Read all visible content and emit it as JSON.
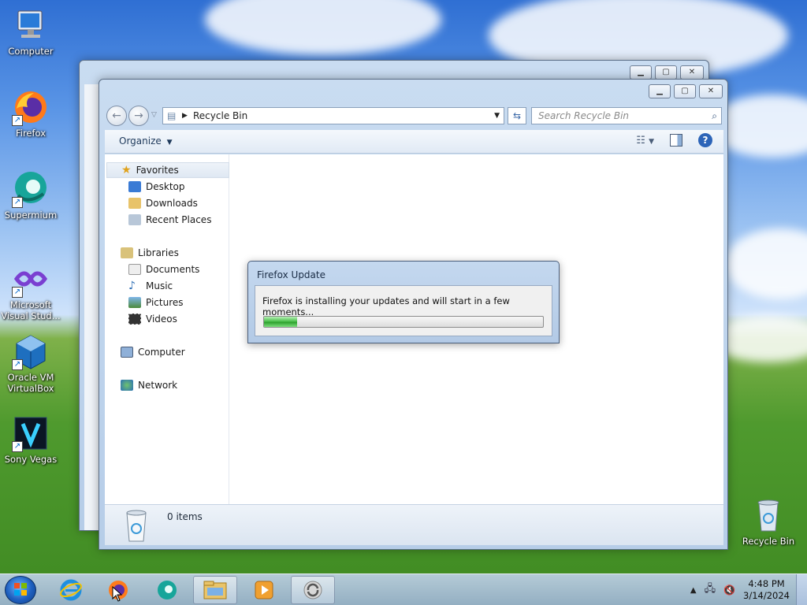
{
  "desktop": {
    "icons": [
      {
        "label": "Computer",
        "icon": "computer-icon"
      },
      {
        "label": "Firefox",
        "icon": "firefox-icon"
      },
      {
        "label": "Supermium",
        "icon": "supermium-icon"
      },
      {
        "label": "Microsoft Visual Stud...",
        "icon": "visual-studio-icon"
      },
      {
        "label": "Oracle VM VirtualBox",
        "icon": "virtualbox-icon"
      },
      {
        "label": "Sony Vegas",
        "icon": "sony-vegas-icon"
      },
      {
        "label": "Recycle Bin",
        "icon": "recycle-bin-icon"
      }
    ]
  },
  "explorer": {
    "address": "Recycle Bin",
    "search_placeholder": "Search Recycle Bin",
    "organize_label": "Organize",
    "nav": {
      "favorites": "Favorites",
      "desktop": "Desktop",
      "downloads": "Downloads",
      "recent": "Recent Places",
      "libraries": "Libraries",
      "documents": "Documents",
      "music": "Music",
      "pictures": "Pictures",
      "videos": "Videos",
      "computer": "Computer",
      "network": "Network"
    },
    "status_count": "0 items"
  },
  "dialog": {
    "title": "Firefox Update",
    "message": "Firefox is installing your updates and will start in a few moments...",
    "progress": 0.12
  },
  "taskbar": {
    "pinned": [
      "internet-explorer-icon",
      "firefox-icon",
      "supermium-icon",
      "explorer-icon",
      "media-player-icon",
      "firefox-update-icon"
    ],
    "time": "4:48 PM",
    "date": "3/14/2024"
  }
}
